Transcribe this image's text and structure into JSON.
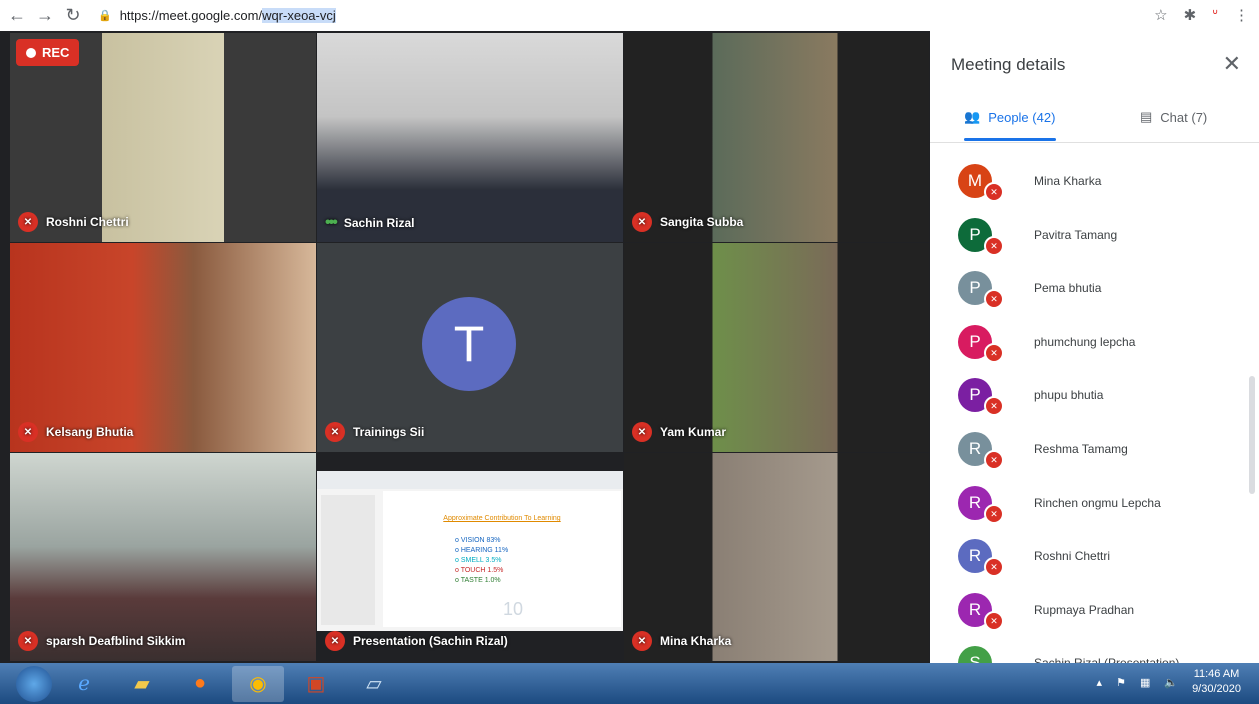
{
  "browser": {
    "url_prefix": "https://meet.google.com/",
    "url_selected": "wqr-xeoa-vcj"
  },
  "rec_label": "REC",
  "tiles": [
    {
      "name": "Roshni Chettri",
      "muted": true
    },
    {
      "name": "Sachin Rizal",
      "muted": false
    },
    {
      "name": "Sangita Subba",
      "muted": true
    },
    {
      "name": "Kelsang Bhutia",
      "muted": true
    },
    {
      "name": "Trainings Sii",
      "muted": true,
      "avatar_letter": "T"
    },
    {
      "name": "Yam Kumar",
      "muted": true
    },
    {
      "name": "sparsh Deafblind Sikkim",
      "muted": true
    },
    {
      "name": "Presentation (Sachin Rizal)",
      "muted": true
    },
    {
      "name": "Mina Kharka",
      "muted": true
    }
  ],
  "slide": {
    "title": "Approximate Contribution To Learning",
    "items": [
      "o VISION   83%",
      "o HEARING 11%",
      "o SMELL    3.5%",
      "o TOUCH   1.5%",
      "o TASTE   1.0%"
    ],
    "page_number": "10"
  },
  "panel": {
    "title": "Meeting details",
    "people_tab": "People (42)",
    "chat_tab": "Chat (7)",
    "people": [
      {
        "letter": "M",
        "name": "Mina Kharka",
        "color": "#d84315"
      },
      {
        "letter": "P",
        "name": "Pavitra Tamang",
        "color": "#0d6b3a"
      },
      {
        "letter": "P",
        "name": "Pema bhutia",
        "color": "#78909c"
      },
      {
        "letter": "P",
        "name": "phumchung lepcha",
        "color": "#d81b60"
      },
      {
        "letter": "P",
        "name": "phupu bhutia",
        "color": "#7b1fa2"
      },
      {
        "letter": "R",
        "name": "Reshma Tamamg",
        "color": "#78909c"
      },
      {
        "letter": "R",
        "name": "Rinchen ongmu Lepcha",
        "color": "#9c27b0"
      },
      {
        "letter": "R",
        "name": "Roshni Chettri",
        "color": "#5c6bc0"
      },
      {
        "letter": "R",
        "name": "Rupmaya Pradhan",
        "color": "#9c27b0"
      },
      {
        "letter": "S",
        "name": "Sachin Rizal (Presentation)",
        "color": "#43a047"
      }
    ]
  },
  "taskbar": {
    "time": "11:46 AM",
    "date": "9/30/2020"
  },
  "colors": {
    "accent": "#1a73e8",
    "muted_red": "#d93025"
  }
}
